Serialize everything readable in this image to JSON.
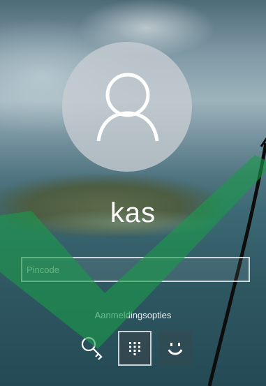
{
  "user": {
    "name": "kas"
  },
  "pin_field": {
    "placeholder": "Pincode",
    "value": ""
  },
  "sign_in": {
    "options_label": "Aanmeldingsopties"
  },
  "options": [
    {
      "icon": "security-key-icon"
    },
    {
      "icon": "pin-keypad-icon"
    },
    {
      "icon": "face-recognition-icon"
    }
  ],
  "colors": {
    "checkmark": "#1b9a4a",
    "text": "#ffffff"
  }
}
